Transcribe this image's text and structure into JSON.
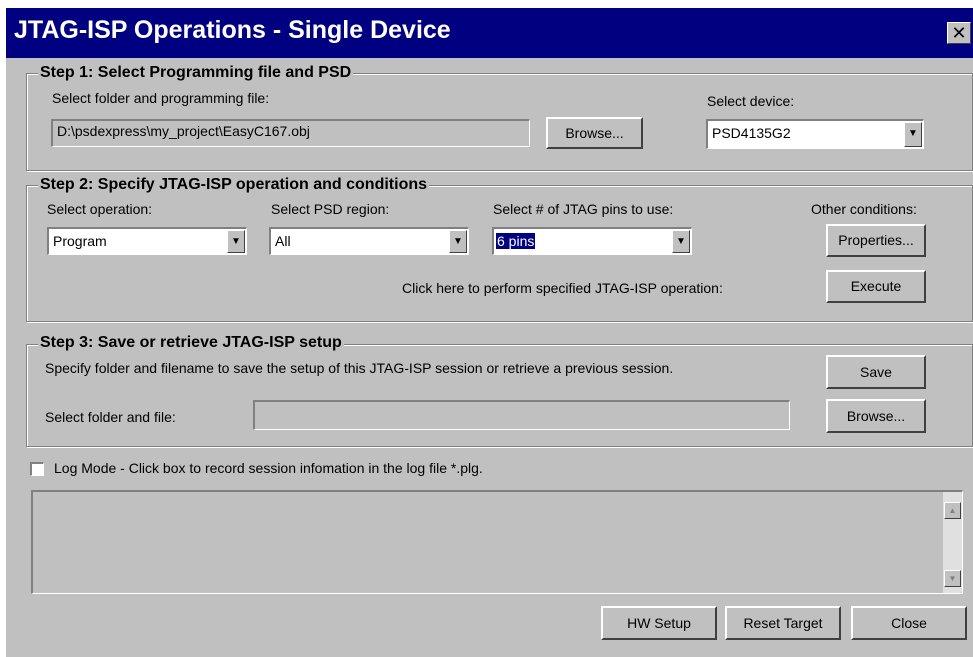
{
  "window": {
    "title": "JTAG-ISP Operations - Single Device",
    "close_glyph": "✕"
  },
  "step1": {
    "legend": "Step 1: Select Programming file and PSD",
    "file_label": "Select folder and programming file:",
    "file_value": "D:\\psdexpress\\my_project\\EasyC167.obj",
    "browse_label": "Browse...",
    "device_label": "Select device:",
    "device_value": "PSD4135G2"
  },
  "step2": {
    "legend": "Step 2: Specify JTAG-ISP operation and conditions",
    "operation_label": "Select operation:",
    "operation_value": "Program",
    "region_label": "Select PSD region:",
    "region_value": "All",
    "pins_label": "Select # of JTAG pins to use:",
    "pins_value": "6 pins",
    "other_label": "Other conditions:",
    "properties_label": "Properties...",
    "execute_hint": "Click here to perform specified JTAG-ISP operation:",
    "execute_label": "Execute"
  },
  "step3": {
    "legend": "Step 3: Save or retrieve JTAG-ISP setup",
    "description": "Specify folder and filename to save the setup of this JTAG-ISP session or retrieve a previous session.",
    "save_label": "Save",
    "file_label": "Select folder and file:",
    "file_value": "",
    "browse_label": "Browse..."
  },
  "log": {
    "checkbox_label": "Log Mode - Click box to record session infomation in the log file *.plg.",
    "checked": false
  },
  "footer": {
    "hw_setup_label": "HW Setup",
    "reset_target_label": "Reset Target",
    "close_label": "Close"
  },
  "icons": {
    "dropdown": "▼",
    "scroll_up": "▲",
    "scroll_down": "▼"
  },
  "colors": {
    "titlebar": "#000080",
    "face": "#c0c0c0",
    "selection": "#000080"
  }
}
